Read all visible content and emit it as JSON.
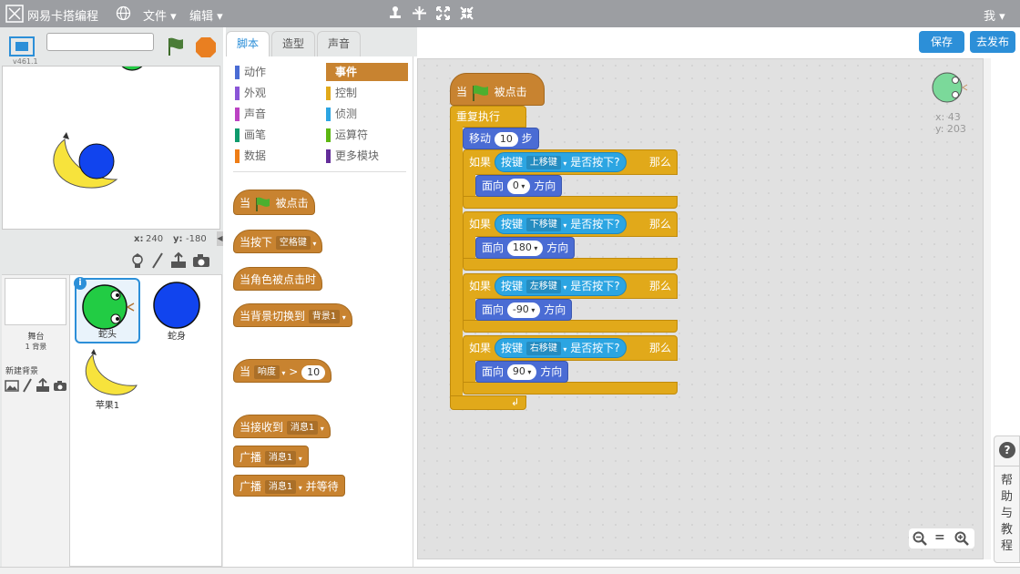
{
  "topbar": {
    "brand": "网易卡搭编程",
    "menu_file": "文件 ▾",
    "menu_edit": "编辑 ▾",
    "user": "我 ▾",
    "tools": [
      "duplicate-icon",
      "delete-icon",
      "grow-icon",
      "shrink-icon"
    ]
  },
  "stage": {
    "version": "v461.1",
    "name_placeholder": "",
    "coord_x_label": "x:",
    "coord_x": "240",
    "coord_y_label": "y:",
    "coord_y": "-180"
  },
  "sprites_panel": {
    "stage_label": "舞台",
    "backdrop_count": "1 背景",
    "new_backdrop": "新建背景",
    "sprites": [
      {
        "name": "蛇头",
        "selected": true
      },
      {
        "name": "蛇身",
        "selected": false
      },
      {
        "name": "苹果1",
        "selected": false
      }
    ]
  },
  "tabs": [
    "脚本",
    "造型",
    "声音"
  ],
  "categories": [
    {
      "label": "动作",
      "color": "#4a6cd4"
    },
    {
      "label": "事件",
      "color": "#c88330",
      "active": true
    },
    {
      "label": "外观",
      "color": "#8a55d7"
    },
    {
      "label": "控制",
      "color": "#e1a91a"
    },
    {
      "label": "声音",
      "color": "#bb42c3"
    },
    {
      "label": "侦测",
      "color": "#2ca5e2"
    },
    {
      "label": "画笔",
      "color": "#0e9a6c"
    },
    {
      "label": "运算符",
      "color": "#5cb712"
    },
    {
      "label": "数据",
      "color": "#ee7d16"
    },
    {
      "label": "更多模块",
      "color": "#632d99"
    }
  ],
  "palette": {
    "b1_pre": "当",
    "b1_post": "被点击",
    "b2": "当按下",
    "b2_dd": "空格键",
    "b3": "当角色被点击时",
    "b4": "当背景切换到",
    "b4_dd": "背景1",
    "b5": "当",
    "b5_dd": "响度",
    "b5_op": ">",
    "b5_val": "10",
    "b6": "当接收到",
    "b6_dd": "消息1",
    "b7": "广播",
    "b7_dd": "消息1",
    "b8": "广播",
    "b8_dd": "消息1",
    "b8_post": "并等待"
  },
  "script": {
    "hat_pre": "当",
    "hat_post": "被点击",
    "forever": "重复执行",
    "move": "移动",
    "move_val": "10",
    "move_unit": "步",
    "ifs": [
      {
        "if": "如果",
        "key": "按键",
        "key_dd": "上移键",
        "pressed": "是否按下?",
        "then": "那么",
        "face": "面向",
        "dir": "0",
        "dir_unit": "方向"
      },
      {
        "if": "如果",
        "key": "按键",
        "key_dd": "下移键",
        "pressed": "是否按下?",
        "then": "那么",
        "face": "面向",
        "dir": "180",
        "dir_unit": "方向"
      },
      {
        "if": "如果",
        "key": "按键",
        "key_dd": "左移键",
        "pressed": "是否按下?",
        "then": "那么",
        "face": "面向",
        "dir": "-90",
        "dir_unit": "方向"
      },
      {
        "if": "如果",
        "key": "按键",
        "key_dd": "右移键",
        "pressed": "是否按下?",
        "then": "那么",
        "face": "面向",
        "dir": "90",
        "dir_unit": "方向"
      }
    ],
    "sprite_x": "x: 43",
    "sprite_y": "y: 203"
  },
  "buttons": {
    "save": "保存",
    "publish": "去发布"
  },
  "help": {
    "q": "?",
    "label": [
      "帮",
      "助",
      "与",
      "教",
      "程"
    ]
  },
  "zoom": {
    "out": "−",
    "reset": "=",
    "in": "+"
  }
}
